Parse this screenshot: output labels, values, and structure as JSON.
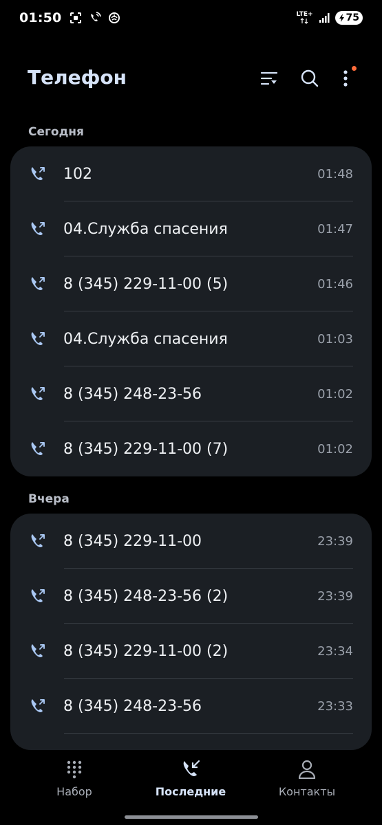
{
  "status_bar": {
    "time": "01:50",
    "network": "LTE+",
    "battery": "75"
  },
  "header": {
    "title": "Телефон"
  },
  "sections": [
    {
      "label": "Сегодня",
      "calls": [
        {
          "name": "102",
          "time": "01:48"
        },
        {
          "name": "04.Служба спасения",
          "time": "01:47"
        },
        {
          "name": "8 (345) 229-11-00 (5)",
          "time": "01:46"
        },
        {
          "name": "04.Служба спасения",
          "time": "01:03"
        },
        {
          "name": "8 (345) 248-23-56",
          "time": "01:02"
        },
        {
          "name": "8 (345) 229-11-00 (7)",
          "time": "01:02"
        }
      ]
    },
    {
      "label": "Вчера",
      "calls": [
        {
          "name": "8 (345) 229-11-00",
          "time": "23:39"
        },
        {
          "name": "8 (345) 248-23-56 (2)",
          "time": "23:39"
        },
        {
          "name": "8 (345) 229-11-00 (2)",
          "time": "23:34"
        },
        {
          "name": "8 (345) 248-23-56",
          "time": "23:33"
        }
      ]
    }
  ],
  "bottom_nav": {
    "items": [
      {
        "label": "Набор",
        "icon": "dialpad-icon"
      },
      {
        "label": "Последние",
        "icon": "recent-calls-icon",
        "active": true
      },
      {
        "label": "Контакты",
        "icon": "contacts-icon"
      }
    ]
  },
  "colors": {
    "background": "#000000",
    "card": "#1b1f24",
    "accent": "#d6e3f8",
    "call_icon": "#a9c7f2",
    "notification_dot": "#ff6b3a"
  }
}
